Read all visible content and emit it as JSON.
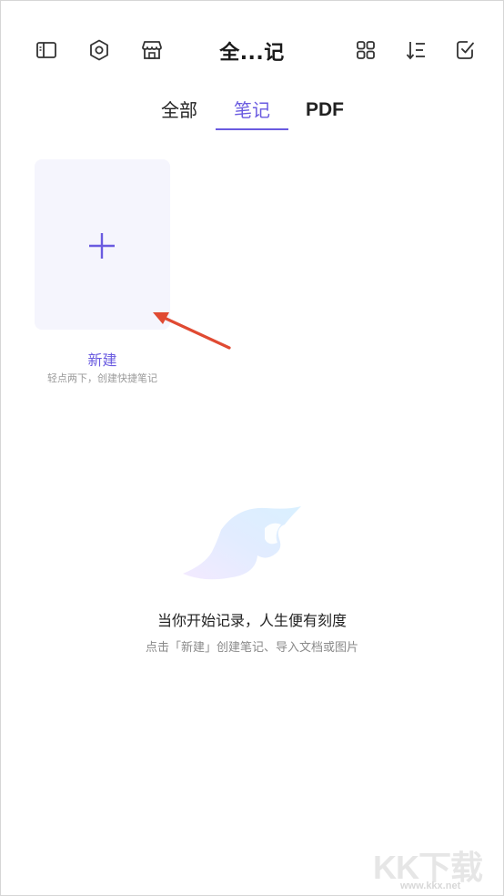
{
  "header": {
    "title": "全...记",
    "icons": [
      "sidebar-icon",
      "settings-icon",
      "store-icon",
      "grid-view-icon",
      "sort-icon",
      "select-icon"
    ]
  },
  "tabs": [
    {
      "label": "全部",
      "active": false
    },
    {
      "label": "笔记",
      "active": true
    },
    {
      "label": "PDF",
      "active": false
    }
  ],
  "new_card": {
    "title": "新建",
    "subtitle": "轻点两下，创建快捷笔记"
  },
  "empty_state": {
    "title": "当你开始记录，人生便有刻度",
    "subtitle": "点击「新建」创建笔记、导入文档或图片"
  },
  "watermark": {
    "text": "KK下载",
    "url": "www.kkx.net"
  },
  "colors": {
    "accent": "#6a5be0",
    "card_bg": "#f5f5fd",
    "arrow": "#e04a32"
  }
}
